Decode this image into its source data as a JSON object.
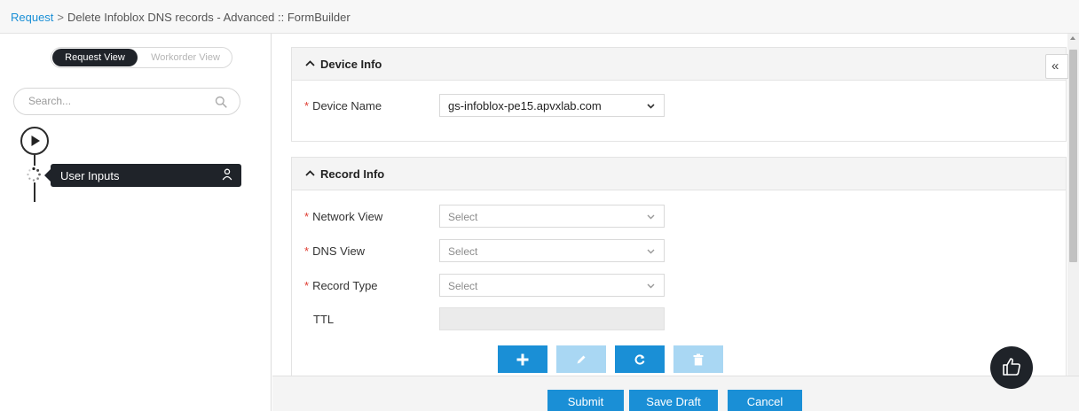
{
  "breadcrumb": {
    "root": "Request",
    "separator": ">",
    "current": "Delete Infoblox DNS records - Advanced :: FormBuilder"
  },
  "sidebar": {
    "view_toggle": {
      "active": "Request View",
      "inactive": "Workorder View"
    },
    "search_placeholder": "Search...",
    "flow_node": {
      "label": "User Inputs"
    }
  },
  "panels": {
    "device_info": {
      "title": "Device Info",
      "fields": {
        "device_name": {
          "label": "Device Name",
          "required_mark": "*",
          "value": "gs-infoblox-pe15.apvxlab.com"
        }
      }
    },
    "record_info": {
      "title": "Record Info",
      "fields": {
        "network_view": {
          "label": "Network View",
          "required_mark": "*",
          "placeholder": "Select"
        },
        "dns_view": {
          "label": "DNS View",
          "required_mark": "*",
          "placeholder": "Select"
        },
        "record_type": {
          "label": "Record Type",
          "required_mark": "*",
          "placeholder": "Select"
        },
        "ttl": {
          "label": "TTL",
          "value": ""
        }
      },
      "actions": [
        "add-icon",
        "edit-icon",
        "refresh-icon",
        "delete-icon"
      ]
    }
  },
  "collapse_glyph": "«",
  "footer": {
    "submit": "Submit",
    "save_draft": "Save Draft",
    "cancel": "Cancel"
  },
  "colors": {
    "primary": "#1a8fd6",
    "primary_disabled": "#a9d7f3",
    "dark": "#1f2329",
    "required": "#e03c31"
  }
}
